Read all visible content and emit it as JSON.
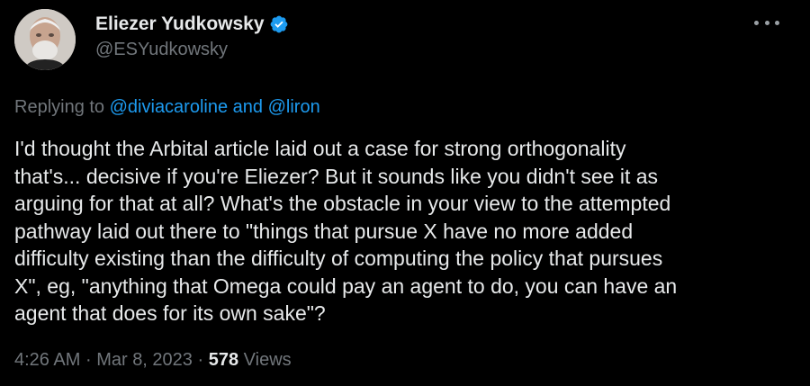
{
  "author": {
    "display_name": "Eliezer Yudkowsky",
    "handle": "@ESYudkowsky",
    "verified": true,
    "avatar_icon": "user-avatar-photo"
  },
  "menu": {
    "icon": "more-options-icon"
  },
  "reply": {
    "prefix": "Replying to",
    "mention_1": "@diviacaroline",
    "conjunction": "and",
    "mention_2": "@liron"
  },
  "body": {
    "lines": [
      "I'd thought the Arbital article laid out a case for strong orthogonality",
      "that's... decisive if you're Eliezer?  But it sounds like you didn't see it as",
      "arguing for that at all?  What's the obstacle in your view to the attempted",
      "pathway laid out there to \"things that pursue X have no more added",
      "difficulty existing than the difficulty of computing the policy that pursues",
      "X\", eg, \"anything that Omega could pay an agent to do, you can have an",
      "agent that does for its own sake\"?"
    ]
  },
  "meta": {
    "time": "4:26 AM",
    "separator": "·",
    "date": "Mar 8, 2023",
    "views_count": "578",
    "views_label": "Views"
  },
  "colors": {
    "background": "#000000",
    "text": "#e7e9ea",
    "secondary": "#71767b",
    "link": "#1d9bf0",
    "verified": "#1d9bf0"
  }
}
